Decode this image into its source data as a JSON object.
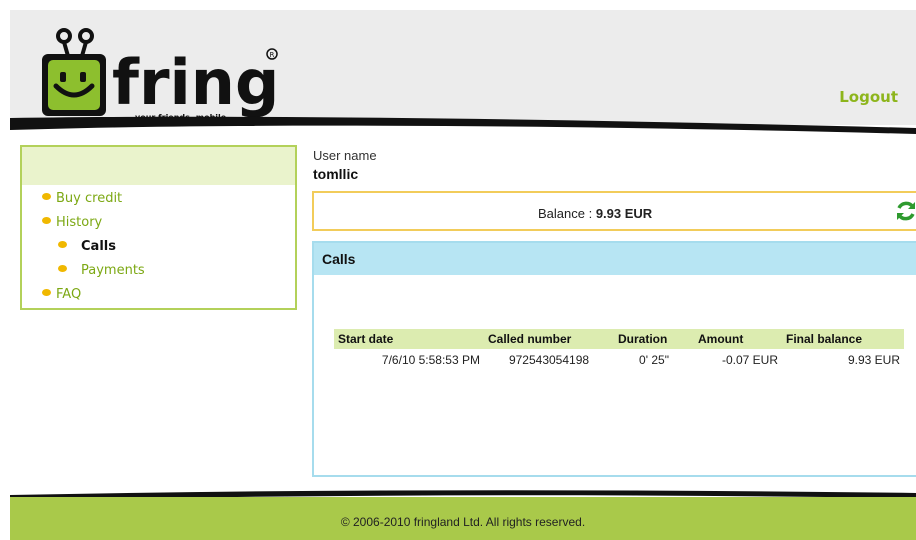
{
  "header": {
    "logo_text": "fring",
    "logo_tagline": "your friends, mobile",
    "logout_label": "Logout"
  },
  "sidebar": {
    "items": [
      {
        "label": "Buy credit",
        "level": 1
      },
      {
        "label": "History",
        "level": 1
      },
      {
        "label": "Calls",
        "level": 2,
        "active": true
      },
      {
        "label": "Payments",
        "level": 2
      },
      {
        "label": "FAQ",
        "level": 1
      }
    ]
  },
  "user": {
    "label": "User name",
    "value": "tomllic"
  },
  "balance": {
    "label": "Balance : ",
    "value": "9.93 EUR",
    "refresh_icon": "refresh-icon"
  },
  "calls": {
    "title": "Calls",
    "columns": [
      "Start date",
      "Called number",
      "Duration",
      "Amount",
      "Final balance"
    ],
    "rows": [
      [
        "7/6/10 5:58:53 PM",
        "972543054198",
        "0' 25\"",
        "-0.07 EUR",
        "9.93 EUR"
      ]
    ]
  },
  "footer": {
    "copyright": "© 2006-2010 fringland Ltd. All rights reserved."
  },
  "colors": {
    "brand_green": "#8db51c",
    "sidebar_border": "#b3d15a",
    "balance_border": "#f2cc5a",
    "calls_header": "#b7e5f3",
    "footer": "#a9c94a"
  }
}
